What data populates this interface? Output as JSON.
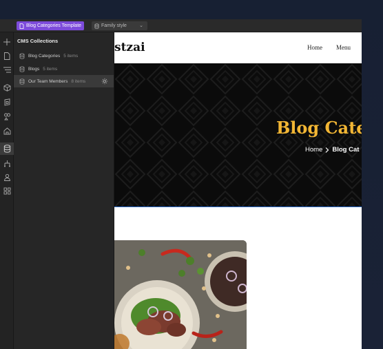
{
  "topbar": {
    "template_label": "Blog Categories Template",
    "style_label": "Family style",
    "colors": {
      "template_pill": "#7d4bdb",
      "style_pill": "#3a3a3a"
    }
  },
  "rail": {
    "icons": [
      "plus-icon",
      "page-icon",
      "navigator-icon",
      "box-icon",
      "components-icon",
      "assets-icon",
      "home-icon",
      "database-icon",
      "logic-icon",
      "users-icon",
      "apps-icon"
    ],
    "active": "database-icon"
  },
  "cms": {
    "title": "CMS Collections",
    "collections": [
      {
        "name": "Blog Categories",
        "count": "5 items"
      },
      {
        "name": "Blogs",
        "count": "5 items"
      },
      {
        "name": "Our Team Members",
        "count": "8 items"
      }
    ]
  },
  "site": {
    "logo": "stzai",
    "nav": [
      "Home",
      "Menu"
    ],
    "hero_title": "Blog Cate",
    "breadcrumb": {
      "home": "Home",
      "current": "Blog Cat"
    },
    "accent": "#f2b634"
  }
}
